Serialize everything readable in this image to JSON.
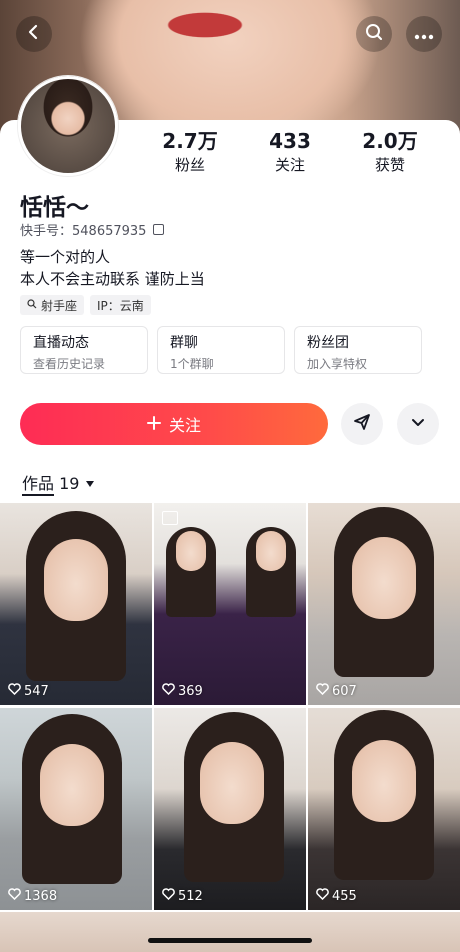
{
  "header": {
    "back_icon": "chevron-left-icon",
    "search_icon": "search-icon",
    "more_icon": "more-dots-icon"
  },
  "profile": {
    "name": "恬恬～",
    "kuaishou_id": "快手号：548657935",
    "bio_line1": "等一个对的人",
    "bio_line2": "本人不会主动联系 谨防上当",
    "tags": [
      {
        "label": "射手座",
        "icon": "search-small-icon"
      },
      {
        "label": "IP：云南"
      }
    ]
  },
  "stats": [
    {
      "value": "2.7万",
      "label": "粉丝"
    },
    {
      "value": "433",
      "label": "关注"
    },
    {
      "value": "2.0万",
      "label": "获赞"
    }
  ],
  "tiles": [
    {
      "title": "直播动态",
      "subtitle": "查看历史记录"
    },
    {
      "title": "群聊",
      "subtitle": "1个群聊"
    },
    {
      "title": "粉丝团",
      "subtitle": "加入享特权"
    }
  ],
  "actions": {
    "follow_label": "关注",
    "follow_icon": "plus-icon",
    "share_icon": "send-icon",
    "expand_icon": "chevron-down-icon"
  },
  "works": {
    "tab_label": "作品 19",
    "items": [
      {
        "likes": "547"
      },
      {
        "likes": "369"
      },
      {
        "likes": "607"
      },
      {
        "likes": "1368"
      },
      {
        "likes": "512"
      },
      {
        "likes": "455"
      }
    ]
  },
  "colors": {
    "accent": "#fe2c55",
    "text": "#161823"
  }
}
